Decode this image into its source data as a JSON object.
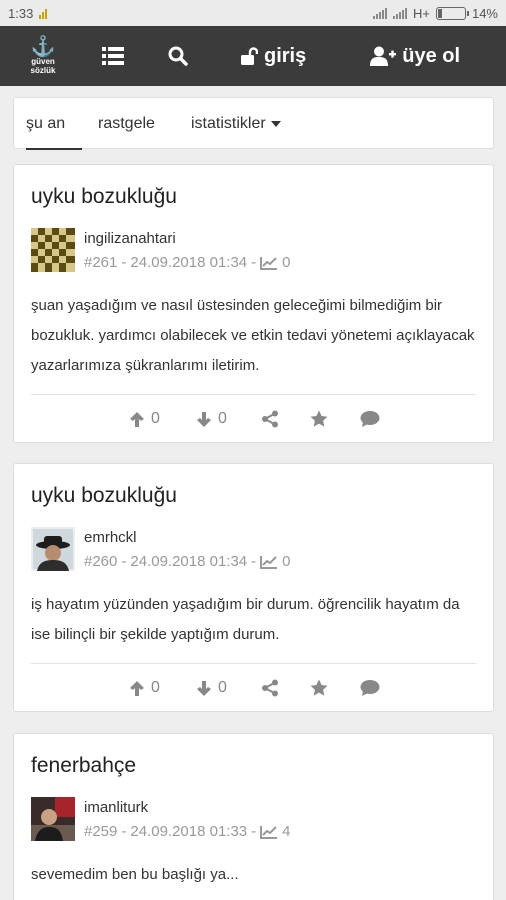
{
  "status": {
    "time": "1:33",
    "network": "H+",
    "battery": "14%",
    "battery_level": 0.14
  },
  "nav": {
    "logo_line1": "güven",
    "logo_line2": "sözlük",
    "login_label": "giriş",
    "register_label": "üye ol"
  },
  "tabs": [
    {
      "label": "şu an",
      "active": true
    },
    {
      "label": "rastgele",
      "active": false
    },
    {
      "label": "istatistikler",
      "active": false,
      "dropdown": true
    }
  ],
  "entries": [
    {
      "title": "uyku bozukluğu",
      "author": "ingilizanahtari",
      "number": "#261",
      "date": "24.09.2018 01:34",
      "views": "0",
      "content": "şuan yaşadığım ve nasıl üstesinden geleceğimi bilmediğim bir bozukluk. yardımcı olabilecek ve etkin tedavi yönetemi açıklayacak yazarlarımıza şükranlarımı iletirim.",
      "upvotes": "0",
      "downvotes": "0"
    },
    {
      "title": "uyku bozukluğu",
      "author": "emrhckl",
      "number": "#260",
      "date": "24.09.2018 01:34",
      "views": "0",
      "content": "iş hayatım yüzünden yaşadığım bir durum. öğrencilik hayatım da ise bilinçli bir şekilde yaptığım durum.",
      "upvotes": "0",
      "downvotes": "0"
    },
    {
      "title": "fenerbahçe",
      "author": "imanliturk",
      "number": "#259",
      "date": "24.09.2018 01:33",
      "views": "4",
      "content": "sevemedim ben bu başlığı ya..."
    }
  ],
  "colors": {
    "navbar": "#3b3b3b",
    "background": "#eeeeee",
    "icon_gray": "#888888"
  }
}
